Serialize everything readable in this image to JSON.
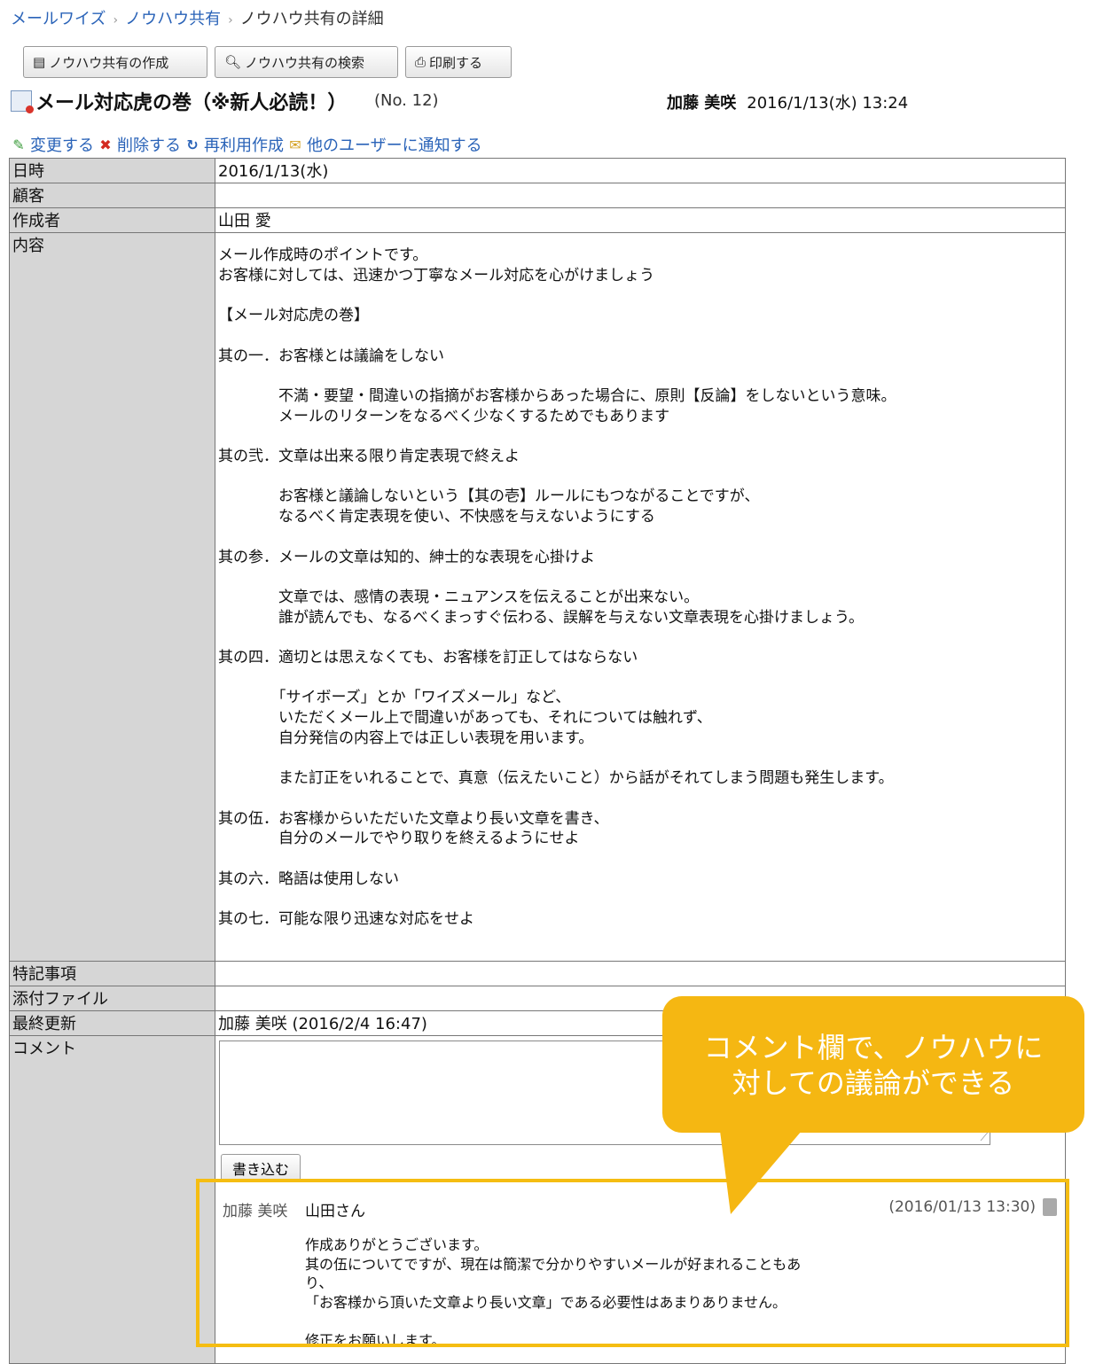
{
  "breadcrumb": [
    "メールワイズ",
    "ノウハウ共有",
    "ノウハウ共有の詳細"
  ],
  "toolbar": {
    "create_label": "ノウハウ共有の作成",
    "search_label": "ノウハウ共有の検索",
    "print_label": "印刷する"
  },
  "entry": {
    "title": "メール対応虎の巻（※新人必読！）",
    "number": "(No. 12)",
    "author": "加藤 美咲",
    "datetime": "2016/1/13(水) 13:24"
  },
  "actions": {
    "edit": "変更する",
    "delete": "削除する",
    "reuse": "再利用作成",
    "notify": "他のユーザーに通知する"
  },
  "fields": {
    "date_label": "日時",
    "date_value": "2016/1/13(水)",
    "customer_label": "顧客",
    "customer_value": "",
    "creator_label": "作成者",
    "creator_value": "山田 愛",
    "content_label": "内容",
    "content_value": "メール作成時のポイントです。\nお客様に対しては、迅速かつ丁寧なメール対応を心がけましょう\n\n【メール対応虎の巻】\n\n其の一．お客様とは議論をしない\n\n　　　　不満・要望・間違いの指摘がお客様からあった場合に、原則【反論】をしないという意味。\n　　　　メールのリターンをなるべく少なくするためでもあります\n\n其の弐．文章は出来る限り肯定表現で終えよ\n\n　　　　お客様と議論しないという【其の壱】ルールにもつながることですが、\n　　　　なるべく肯定表現を使い、不快感を与えないようにする\n\n其の参．メールの文章は知的、紳士的な表現を心掛けよ\n\n　　　　文章では、感情の表現・ニュアンスを伝えることが出来ない。\n　　　　誰が読んでも、なるべくまっすぐ伝わる、誤解を与えない文章表現を心掛けましょう。\n\n其の四．適切とは思えなくても、お客様を訂正してはならない\n\n　　　　「サイボーズ」とか「ワイズメール」など、\n　　　　いただくメール上で間違いがあっても、それについては触れず、\n　　　　自分発信の内容上では正しい表現を用います。\n\n　　　　また訂正をいれることで、真意（伝えたいこと）から話がそれてしまう問題も発生します。\n\n其の伍．お客様からいただいた文章より長い文章を書き、\n　　　　自分のメールでやり取りを終えるようにせよ\n\n其の六．略語は使用しない\n\n其の七．可能な限り迅速な対応をせよ",
    "notes_label": "特記事項",
    "notes_value": "",
    "attach_label": "添付ファイル",
    "attach_value": "",
    "updated_label": "最終更新",
    "updated_value": "加藤 美咲 (2016/2/4 16:47)",
    "comment_label": "コメント"
  },
  "comment_form": {
    "submit_label": "書き込む"
  },
  "comment": {
    "author": "加藤 美咲",
    "to": "山田さん",
    "time": "(2016/01/13 13:30)",
    "body": "作成ありがとうございます。\n其の伍についてですが、現在は簡潔で分かりやすいメールが好まれることもあ\nり、\n「お客様から頂いた文章より長い文章」である必要性はあまりありません。\n\n修正をお願いします。"
  },
  "callout": {
    "line1": "コメント欄で、ノウハウに",
    "line2": "対しての議論ができる"
  },
  "colors": {
    "link": "#2a63b8",
    "label_bg": "#d6d6d6",
    "callout": "#f5b712"
  }
}
